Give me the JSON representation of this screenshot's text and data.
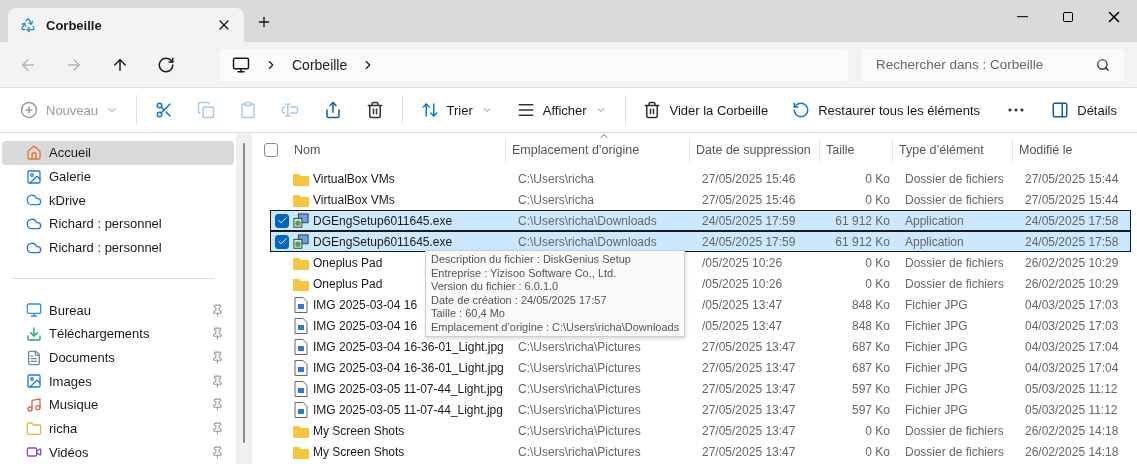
{
  "window": {
    "tab_title": "Corbeille"
  },
  "nav": {
    "buttons": [
      {
        "disabled": true
      },
      {
        "disabled": true
      },
      {
        "disabled": false
      },
      {
        "disabled": false
      }
    ],
    "breadcrumb": [
      "Corbeille"
    ],
    "search": {
      "placeholder": "Rechercher dans : Corbeille"
    }
  },
  "toolbar": {
    "items": [
      {
        "kind": "menu",
        "label": "Nouveau",
        "disabled": true
      },
      {
        "kind": "icon",
        "disabled": false
      },
      {
        "kind": "icon",
        "disabled": true
      },
      {
        "kind": "icon",
        "disabled": true
      },
      {
        "kind": "icon",
        "disabled": true
      },
      {
        "kind": "icon",
        "disabled": false
      },
      {
        "kind": "icon",
        "disabled": false
      },
      {
        "kind": "menu",
        "label": "Trier",
        "disabled": false
      },
      {
        "kind": "menu",
        "label": "Afficher",
        "disabled": false
      },
      {
        "kind": "button",
        "label": "Vider la Corbeille",
        "disabled": false
      },
      {
        "kind": "button",
        "label": "Restaurer tous les éléments",
        "disabled": false
      },
      {
        "kind": "more",
        "disabled": false
      }
    ],
    "details": "Détails"
  },
  "sidebar": {
    "groups": [
      {
        "items": [
          {
            "label": "Accueil",
            "selected": true,
            "pinned": false
          },
          {
            "label": "Galerie",
            "selected": false,
            "pinned": false
          },
          {
            "label": "kDrive",
            "selected": false,
            "pinned": false
          },
          {
            "label": "Richard : personnel",
            "selected": false,
            "pinned": false
          },
          {
            "label": "Richard : personnel",
            "selected": false,
            "pinned": false
          }
        ]
      },
      {
        "items": [
          {
            "label": "Bureau",
            "selected": false,
            "pinned": true
          },
          {
            "label": "Téléchargements",
            "selected": false,
            "pinned": true
          },
          {
            "label": "Documents",
            "selected": false,
            "pinned": true
          },
          {
            "label": "Images",
            "selected": false,
            "pinned": true
          },
          {
            "label": "Musique",
            "selected": false,
            "pinned": true
          },
          {
            "label": "richa",
            "selected": false,
            "pinned": true
          },
          {
            "label": "Vidéos",
            "selected": false,
            "pinned": true
          }
        ]
      }
    ]
  },
  "table": {
    "select_all": {
      "checked": false
    },
    "columns": [
      {
        "label": "Nom",
        "sorted": false
      },
      {
        "label": "Emplacement d’origine",
        "sorted": true
      },
      {
        "label": "Date de suppression",
        "sorted": false
      },
      {
        "label": "Taille",
        "sorted": false
      },
      {
        "label": "Type d’élément",
        "sorted": false
      },
      {
        "label": "Modifié le",
        "sorted": false
      }
    ],
    "rows": [
      {
        "kind": "folder",
        "selected": false,
        "name": "VirtualBox VMs",
        "location": "C:\\Users\\richa",
        "deleted": "27/05/2025 15:46",
        "size": "0 Ko",
        "type": "Dossier de fichiers",
        "modified": "27/05/2025 15:44"
      },
      {
        "kind": "folder",
        "selected": false,
        "name": "VirtualBox VMs",
        "location": "C:\\Users\\richa",
        "deleted": "27/05/2025 15:46",
        "size": "0 Ko",
        "type": "Dossier de fichiers",
        "modified": "27/05/2025 15:44"
      },
      {
        "kind": "exe",
        "selected": true,
        "name": "DGEngSetup6011645.exe",
        "location": "C:\\Users\\richa\\Downloads",
        "deleted": "24/05/2025 17:59",
        "size": "61 912 Ko",
        "type": "Application",
        "modified": "24/05/2025 17:58"
      },
      {
        "kind": "exe",
        "selected": true,
        "name": "DGEngSetup6011645.exe",
        "location": "C:\\Users\\richa\\Downloads",
        "deleted": "24/05/2025 17:59",
        "size": "61 912 Ko",
        "type": "Application",
        "modified": "24/05/2025 17:58"
      },
      {
        "kind": "folder",
        "selected": false,
        "name": "Oneplus Pad",
        "deleted": "/05/2025 10:26",
        "size": "0 Ko",
        "type": "Dossier de fichiers",
        "modified": "26/02/2025 10:29"
      },
      {
        "kind": "folder",
        "selected": false,
        "name": "Oneplus Pad",
        "deleted": "/05/2025 10:26",
        "size": "0 Ko",
        "type": "Dossier de fichiers",
        "modified": "26/02/2025 10:29"
      },
      {
        "kind": "image",
        "selected": false,
        "name": "IMG 2025-03-04 16",
        "deleted": "/05/2025 13:47",
        "size": "848 Ko",
        "type": "Fichier JPG",
        "modified": "04/03/2025 17:03"
      },
      {
        "kind": "image",
        "selected": false,
        "name": "IMG 2025-03-04 16",
        "deleted": "/05/2025 13:47",
        "size": "848 Ko",
        "type": "Fichier JPG",
        "modified": "04/03/2025 17:03"
      },
      {
        "kind": "image",
        "selected": false,
        "name": "IMG 2025-03-04 16-36-01_Light.jpg",
        "location": "C:\\Users\\richa\\Pictures",
        "deleted": "27/05/2025 13:47",
        "size": "687 Ko",
        "type": "Fichier JPG",
        "modified": "04/03/2025 17:04"
      },
      {
        "kind": "image",
        "selected": false,
        "name": "IMG 2025-03-04 16-36-01_Light.jpg",
        "location": "C:\\Users\\richa\\Pictures",
        "deleted": "27/05/2025 13:47",
        "size": "687 Ko",
        "type": "Fichier JPG",
        "modified": "04/03/2025 17:04"
      },
      {
        "kind": "image",
        "selected": false,
        "name": "IMG 2025-03-05 11-07-44_Light.jpg",
        "location": "C:\\Users\\richa\\Pictures",
        "deleted": "27/05/2025 13:47",
        "size": "597 Ko",
        "type": "Fichier JPG",
        "modified": "05/03/2025 11:12"
      },
      {
        "kind": "image",
        "selected": false,
        "name": "IMG 2025-03-05 11-07-44_Light.jpg",
        "location": "C:\\Users\\richa\\Pictures",
        "deleted": "27/05/2025 13:47",
        "size": "597 Ko",
        "type": "Fichier JPG",
        "modified": "05/03/2025 11:12"
      },
      {
        "kind": "folder",
        "selected": false,
        "name": "My Screen Shots",
        "location": "C:\\Users\\richa\\Pictures",
        "deleted": "27/05/2025 13:47",
        "size": "0 Ko",
        "type": "Dossier de fichiers",
        "modified": "26/02/2025 14:18"
      },
      {
        "kind": "folder",
        "selected": false,
        "name": "My Screen Shots",
        "location": "C:\\Users\\richa\\Pictures",
        "deleted": "27/05/2025 13:47",
        "size": "0 Ko",
        "type": "Dossier de fichiers",
        "modified": "26/02/2025 14:18"
      }
    ]
  },
  "tooltip": {
    "lines": [
      "Description du fichier : DiskGenius Setup",
      "Entreprise : Yizisoo Software Co., Ltd.",
      "Version du fichier : 6.0.1.0",
      "Date de création : 24/05/2025 17:57",
      "Taille : 60,4 Mo",
      "Emplacement d’origine : C:\\Users\\richa\\Downloads"
    ]
  }
}
